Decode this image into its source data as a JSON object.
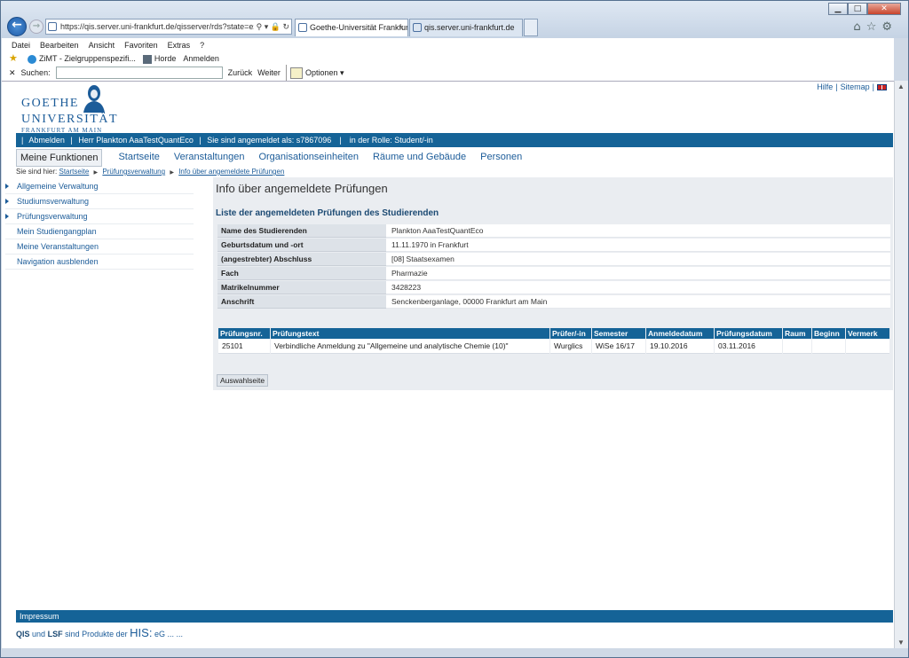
{
  "browser": {
    "address": "https://qis.server.uni-frankfurt.de/qisserver/rds?state=examsinfo",
    "tab_active": "Goethe-Universität Frankfur...",
    "tab_inactive": "qis.server.uni-frankfurt.de",
    "menu": [
      "Datei",
      "Bearbeiten",
      "Ansicht",
      "Favoriten",
      "Extras",
      "?"
    ],
    "favorites": [
      "ZiMT - Zielgruppenspezifi...",
      "Horde",
      "Anmelden"
    ],
    "find_label": "Suchen:",
    "find_prev": "Zurück",
    "find_next": "Weiter",
    "find_options": "Optionen"
  },
  "logo": {
    "line1": "GOETHE",
    "line2": "UNIVERSITÄT",
    "line3": "FRANKFURT AM MAIN"
  },
  "toplinks": {
    "help": "Hilfe",
    "sep": "|",
    "sitemap": "Sitemap"
  },
  "userbar": {
    "logout": "Abmelden",
    "user": "Herr Plankton AaaTestQuantEco",
    "login_as": "Sie sind angemeldet als: s7867096",
    "role": "in der Rolle: Student/-in"
  },
  "mainnav": [
    "Meine Funktionen",
    "Startseite",
    "Veranstaltungen",
    "Organisationseinheiten",
    "Räume und Gebäude",
    "Personen"
  ],
  "breadcrumb": {
    "prefix": "Sie sind hier:",
    "items": [
      "Startseite",
      "Prüfungsverwaltung",
      "Info über angemeldete Prüfungen"
    ]
  },
  "sidenav": [
    "Allgemeine Verwaltung",
    "Studiumsverwaltung",
    "Prüfungsverwaltung",
    "Mein Studiengangplan",
    "Meine Veranstaltungen",
    "Navigation ausblenden"
  ],
  "content": {
    "title": "Info über angemeldete Prüfungen",
    "subtitle": "Liste der angemeldeten Prüfungen des Studierenden",
    "info": [
      {
        "k": "Name des Studierenden",
        "v": "Plankton AaaTestQuantEco"
      },
      {
        "k": "Geburtsdatum und -ort",
        "v": "11.11.1970 in Frankfurt"
      },
      {
        "k": "(angestrebter) Abschluss",
        "v": "[08] Staatsexamen"
      },
      {
        "k": "Fach",
        "v": "Pharmazie"
      },
      {
        "k": "Matrikelnummer",
        "v": "3428223"
      },
      {
        "k": "Anschrift",
        "v": "Senckenberganlage, 00000 Frankfurt am Main"
      }
    ],
    "exam_headers": [
      "Prüfungsnr.",
      "Prüfungstext",
      "Prüfer/-in",
      "Semester",
      "Anmeldedatum",
      "Prüfungsdatum",
      "Raum",
      "Beginn",
      "Vermerk"
    ],
    "exam_row": [
      "25101",
      "Verbindliche Anmeldung zu \"Allgemeine und analytische Chemie (10)\"",
      "Wurglics",
      "WiSe 16/17",
      "19.10.2016",
      "03.11.2016",
      "",
      "",
      ""
    ],
    "back_button": "Auswahlseite"
  },
  "footer": {
    "bar": "Impressum",
    "qis": "QIS",
    "und": "und",
    "lsf": "LSF",
    "rest": "sind Produkte der",
    "his": "HIS:",
    "eg": "eG ... ..."
  }
}
